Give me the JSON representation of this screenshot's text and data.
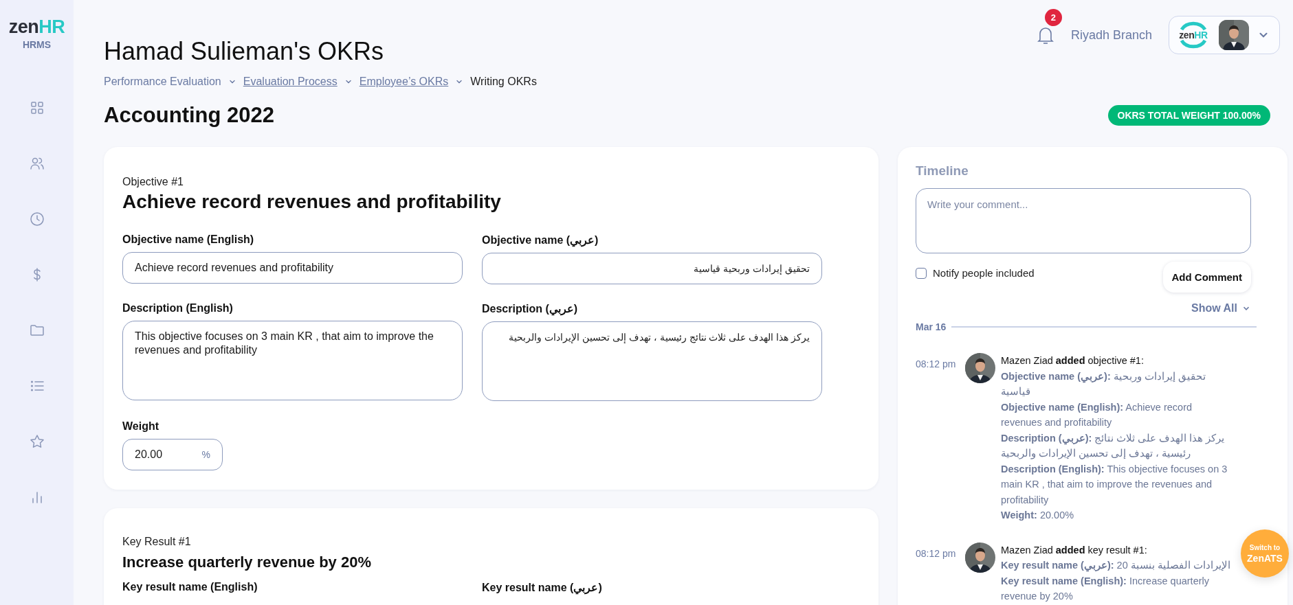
{
  "sidebar": {
    "logo": {
      "word": "zen",
      "accent": "HR"
    },
    "product": "HRMS",
    "items": [
      {
        "kind": "grid"
      },
      {
        "kind": "users"
      },
      {
        "kind": "clock"
      },
      {
        "kind": "dollar"
      },
      {
        "kind": "folder"
      },
      {
        "kind": "list"
      },
      {
        "kind": "star"
      },
      {
        "kind": "chart"
      }
    ]
  },
  "header": {
    "title": "Hamad Sulieman's OKRs",
    "breadcrumb": [
      {
        "label": "Performance Evaluation",
        "link": false
      },
      {
        "label": "Evaluation Process",
        "link": true
      },
      {
        "label": "Employee’s OKRs",
        "link": true
      },
      {
        "label": "Writing OKRs",
        "link": false
      }
    ],
    "notifications": "2",
    "branch": "Riyadh Branch",
    "account_logo": {
      "word": "zen",
      "accent": "HR"
    }
  },
  "section_title": "Accounting 2022",
  "total_weight": "OKRS TOTAL WEIGHT 100.00%",
  "objective": {
    "caption": "Objective #1",
    "title": "Achieve record revenues and profitability",
    "fields": [
      {
        "label": "Objective name (English)",
        "value": "Achieve record revenues and profitability",
        "kind": "input",
        "rtl": false
      },
      {
        "label": "Objective name (عربي)",
        "value": "تحقيق إيرادات وربحية قياسية",
        "kind": "input",
        "rtl": true
      },
      {
        "label": "Description (English)",
        "value": "This objective focuses on 3 main KR , that aim to improve the revenues and profitability",
        "kind": "textarea",
        "rtl": false
      },
      {
        "label": "Description (عربي)",
        "value": "يركز هذا الهدف على ثلاث نتائج رئيسية ، تهدف إلى تحسين الإيرادات والربحية",
        "kind": "textarea",
        "rtl": true
      }
    ],
    "weight": {
      "label": "Weight",
      "value": "20.00",
      "unit": "%"
    }
  },
  "key_result": {
    "caption": "Key Result #1",
    "title": "Increase quarterly revenue by 20%",
    "field_labels": [
      "Key result name (English)",
      "Key result name (عربي)"
    ]
  },
  "timeline": {
    "title": "Timeline",
    "comment": {
      "placeholder": "Write your comment..."
    },
    "notify": {
      "label": "Notify people included",
      "checked": false
    },
    "add_button": "Add Comment",
    "show_all": "Show All",
    "date": "Mar 16",
    "entries": [
      {
        "time": "08:12 pm",
        "heading": "Mazen Ziad **added** objective #1:",
        "lines": [
          "**Objective name (عربي):** تحقيق إيرادات وربحية قياسية",
          "**Objective name (English):** Achieve record revenues and profitability",
          "**Description (عربي):** يركز هذا الهدف على ثلاث نتائج رئيسية ، تهدف إلى تحسين الإيرادات والربحية",
          "**Description (English):** This objective focuses on 3 main KR , that aim to improve the revenues and profitability",
          "**Weight:** 20.00%"
        ]
      },
      {
        "time": "08:12 pm",
        "heading": "Mazen Ziad **added** key result #1:",
        "lines": [
          "**Key result name (عربي):** الإيرادات الفصلية بنسبة 20",
          "**Key result name (English):** Increase quarterly revenue by 20%"
        ]
      }
    ]
  },
  "switch_button": {
    "line_1": "Switch to",
    "line_2": "ZenATS"
  }
}
